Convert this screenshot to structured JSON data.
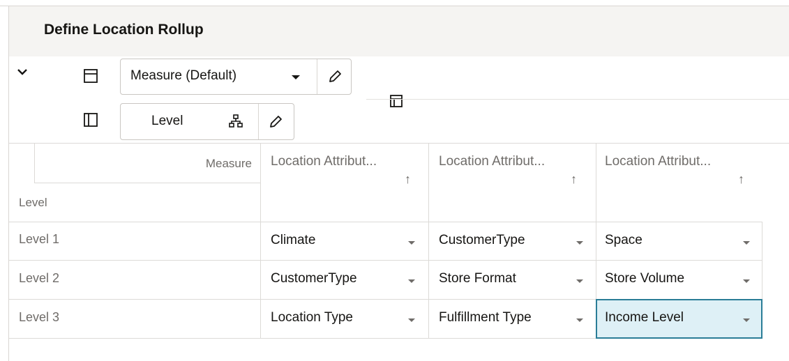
{
  "page": {
    "title": "Define Location Rollup"
  },
  "toolbar": {
    "measure_select": {
      "value": "Measure (Default)"
    },
    "level_select": {
      "value": "Level"
    }
  },
  "grid": {
    "corner_top": "Measure",
    "corner_bottom": "Level",
    "columns": [
      {
        "label": "Location Attribut...",
        "sort": "↑"
      },
      {
        "label": "Location Attribut...",
        "sort": "↑"
      },
      {
        "label": "Location Attribut...",
        "sort": "↑"
      }
    ],
    "rows": [
      {
        "label": "Level 1",
        "values": [
          "Climate",
          "CustomerType",
          "Space"
        ]
      },
      {
        "label": "Level 2",
        "values": [
          "CustomerType",
          "Store Format",
          "Store Volume"
        ]
      },
      {
        "label": "Level 3",
        "values": [
          "Location Type",
          "Fulfillment Type",
          "Income Level"
        ]
      }
    ],
    "selected_cell": {
      "row": 3,
      "column": 3
    }
  },
  "colors": {
    "selected_bg": "#def0f6",
    "selected_border": "#2a7d97",
    "header_text": "#6f6c69"
  },
  "icons": [
    "chevron-down-icon",
    "row-layout-icon",
    "column-layout-icon",
    "pivot-layout-icon",
    "pencil-icon",
    "hierarchy-icon",
    "dropdown-caret-icon",
    "sort-ascending-icon"
  ]
}
